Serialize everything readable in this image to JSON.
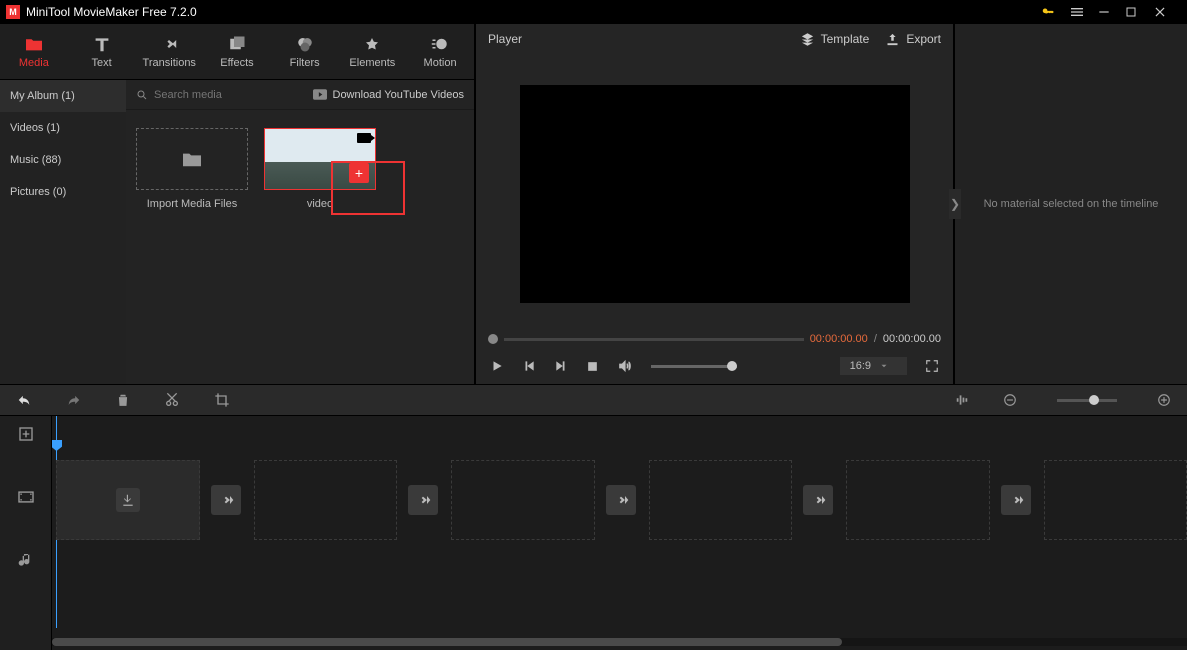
{
  "app_title": "MiniTool MovieMaker Free 7.2.0",
  "tabs": {
    "media": "Media",
    "text": "Text",
    "transitions": "Transitions",
    "effects": "Effects",
    "filters": "Filters",
    "elements": "Elements",
    "motion": "Motion"
  },
  "album": {
    "header": "My Album (1)",
    "items": {
      "videos": "Videos (1)",
      "music": "Music (88)",
      "pictures": "Pictures (0)"
    }
  },
  "search_placeholder": "Search media",
  "download_label": "Download YouTube Videos",
  "import_label": "Import Media Files",
  "clip_name": "video",
  "player": {
    "title": "Player",
    "template": "Template",
    "export": "Export",
    "time_current": "00:00:00.00",
    "time_sep": "/",
    "time_total": "00:00:00.00",
    "ratio": "16:9"
  },
  "side_msg": "No material selected on the timeline"
}
